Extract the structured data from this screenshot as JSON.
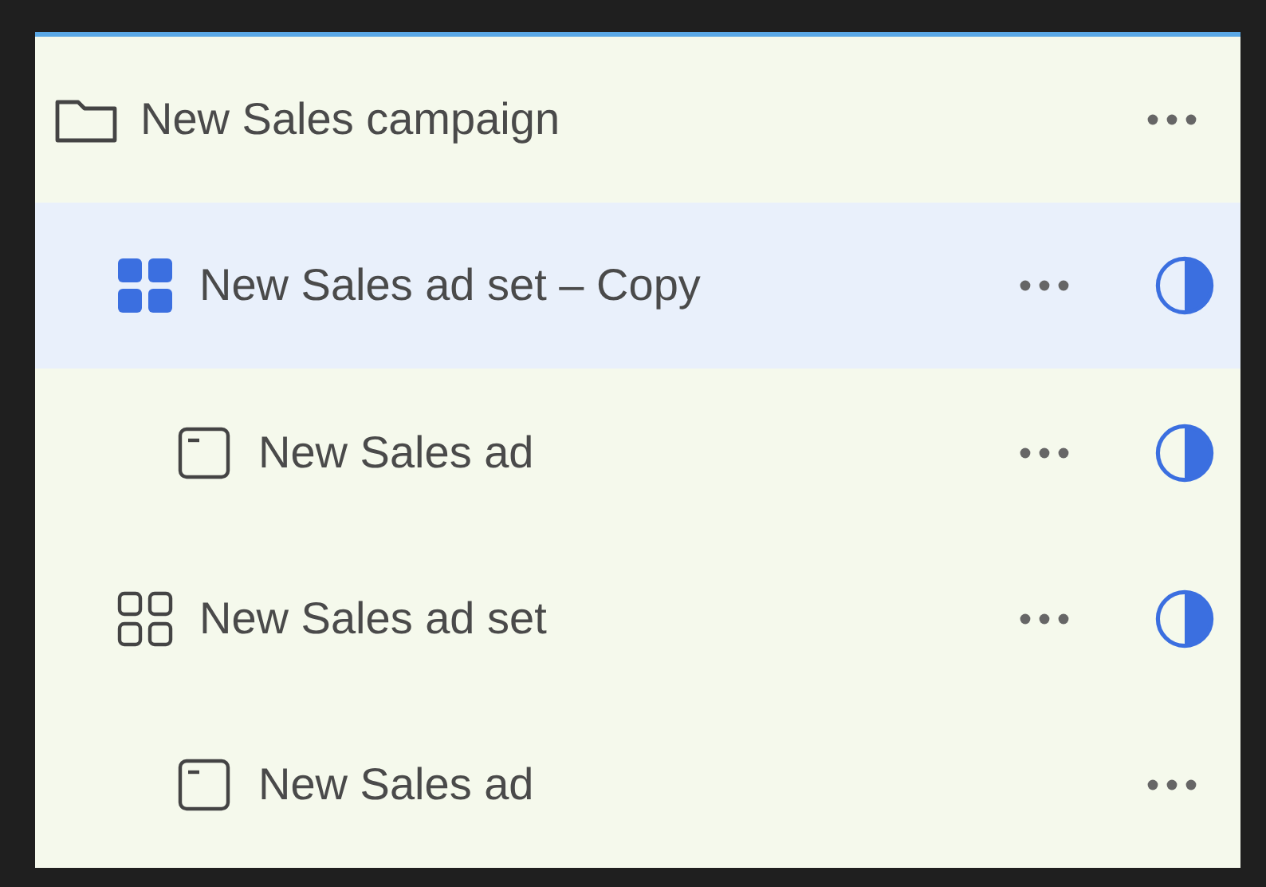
{
  "tree": [
    {
      "kind": "campaign",
      "label": "New Sales campaign",
      "selected": false,
      "status": false,
      "children": [
        {
          "kind": "adset",
          "label": "New Sales ad set – Copy",
          "selected": true,
          "status": true,
          "children": [
            {
              "kind": "ad",
              "label": "New Sales ad",
              "selected": false,
              "status": true
            }
          ]
        },
        {
          "kind": "adset",
          "label": "New Sales ad set",
          "selected": false,
          "status": true,
          "children": [
            {
              "kind": "ad",
              "label": "New Sales ad",
              "selected": false,
              "status": false
            }
          ]
        }
      ]
    }
  ]
}
